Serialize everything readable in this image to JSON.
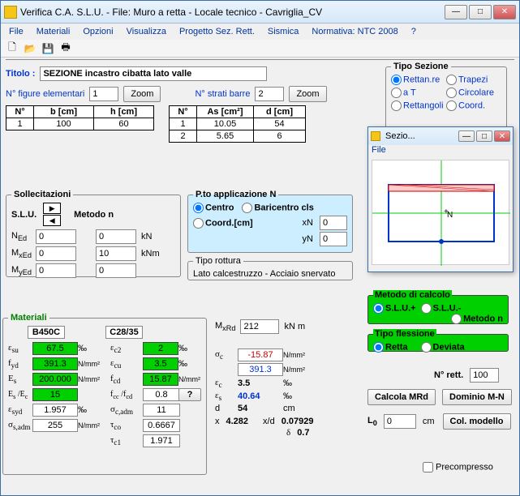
{
  "titlebar": "Verifica C.A. S.L.U. - File: Muro a retta - Locale tecnico - Cavriglia_CV",
  "menu": [
    "File",
    "Materiali",
    "Opzioni",
    "Visualizza",
    "Progetto Sez. Rett.",
    "Sismica",
    "Normativa: NTC 2008",
    "?"
  ],
  "titolo_label": "Titolo :",
  "titolo_value": "SEZIONE incastro cibatta lato valle",
  "n_figure_label": "N° figure elementari",
  "n_figure_value": "1",
  "zoom_label": "Zoom",
  "n_strati_label": "N° strati barre",
  "n_strati_value": "2",
  "table_fig": {
    "headers": [
      "N°",
      "b [cm]",
      "h [cm]"
    ],
    "rows": [
      [
        "1",
        "100",
        "60"
      ]
    ]
  },
  "table_bars": {
    "headers": [
      "N°",
      "As [cm²]",
      "d [cm]"
    ],
    "rows": [
      [
        "1",
        "10.05",
        "54"
      ],
      [
        "2",
        "5.65",
        "6"
      ]
    ]
  },
  "tipo_sezione": {
    "legend": "Tipo Sezione",
    "options": [
      "Rettan.re",
      "Trapezi",
      "a T",
      "Circolare",
      "Rettangoli",
      "Coord."
    ]
  },
  "sollecitazioni": {
    "legend": "Sollecitazioni",
    "slu_label": "S.L.U.",
    "metodo_label": "Metodo n",
    "NEd_label": "N",
    "NEd_sub": "Ed",
    "NEd_val": "0",
    "NEd_val2": "0",
    "NEd_unit": "kN",
    "MxEd_label": "M",
    "MxEd_sub": "xEd",
    "MxEd_val": "0",
    "MxEd_val2": "10",
    "MxEd_unit": "kNm",
    "MyEd_label": "M",
    "MyEd_sub": "yEd",
    "MyEd_val": "0",
    "MyEd_val2": "0"
  },
  "pto_app": {
    "legend": "P.to applicazione N",
    "centro": "Centro",
    "baricentro": "Baricentro cls",
    "coord": "Coord.[cm]",
    "xN": "xN",
    "xN_val": "0",
    "yN": "yN",
    "yN_val": "0"
  },
  "tipo_rottura": {
    "legend": "Tipo rottura",
    "text": "Lato calcestruzzo - Acciaio snervato"
  },
  "metodo_calcolo": {
    "legend": "Metodo di calcolo",
    "opt1": "S.L.U.+",
    "opt2": "S.L.U.-",
    "opt3": "Metodo n"
  },
  "tipo_flessione": {
    "legend": "Tipo flessione",
    "opt1": "Retta",
    "opt2": "Deviata"
  },
  "n_rett_label": "N° rett.",
  "n_rett_val": "100",
  "calcola_btn": "Calcola MRd",
  "dominio_btn": "Dominio M-N",
  "L0_label": "L",
  "L0_sub": "0",
  "L0_val": "0",
  "L0_unit": "cm",
  "col_modello_btn": "Col. modello",
  "precompresso_label": "Precompresso",
  "materiali": {
    "legend": "Materiali",
    "steel": "B450C",
    "conc": "C28/35",
    "esu": "67.5",
    "ec2": "2",
    "fyd": "391.3",
    "ecu": "3.5",
    "Es": "200.000",
    "fcd": "15.87",
    "EsEc": "15",
    "fccfcd": "0.8",
    "esyd": "1.957",
    "scadm": "11",
    "ssadm": "255",
    "tco": "0.6667",
    "tc1": "1.971",
    "lbl_esu": "ε",
    "sub_su": "su",
    "permille": "‰",
    "lbl_ec2": "ε",
    "sub_c2": "c2",
    "lbl_fyd": "f",
    "sub_yd": "yd",
    "nmm2": "N/mm²",
    "lbl_ecu": "ε",
    "sub_cu": "cu",
    "lbl_Es": "E",
    "sub_s": "s",
    "lbl_fcd": "f",
    "sub_cd": "cd",
    "lbl_EsEc": "E",
    "lbl_EsEc2": " /E",
    "sub_c": "c",
    "lbl_fccfcd": "f",
    "sub_cc": "cc",
    "lbl_fccfcd2": " /f",
    "lbl_esyd": "ε",
    "sub_syd": "syd",
    "lbl_scadm": "σ",
    "sub_cadm": "c,adm",
    "lbl_ssadm": "σ",
    "sub_sadm": "s,adm",
    "lbl_tco": "τ",
    "sub_co": "co",
    "lbl_tc1": "τ",
    "sub_c1": "c1",
    "q_btn": "?"
  },
  "results": {
    "MxRd_label": "M",
    "MxRd_sub": "xRd",
    "MxRd_val": "212",
    "MxRd_unit": "kN m",
    "sc_label": "σ",
    "sc_sub": "c",
    "sc_val1": "-15.87",
    "sc_val2": "391.3",
    "nmm2": "N/mm²",
    "ec_label": "ε",
    "ec_val": "3.5",
    "permille": "‰",
    "es_label": "ε",
    "es_sub": "s",
    "es_val": "40.64",
    "d_label": "d",
    "d_val": "54",
    "d_unit": "cm",
    "x_label": "x",
    "x_val": "4.282",
    "xd_label": "x/d",
    "xd_val": "0.07929",
    "delta_label": "δ",
    "delta_val": "0.7"
  },
  "sub_window": {
    "title": "Sezio...",
    "menu": "File",
    "N_label": "N"
  }
}
